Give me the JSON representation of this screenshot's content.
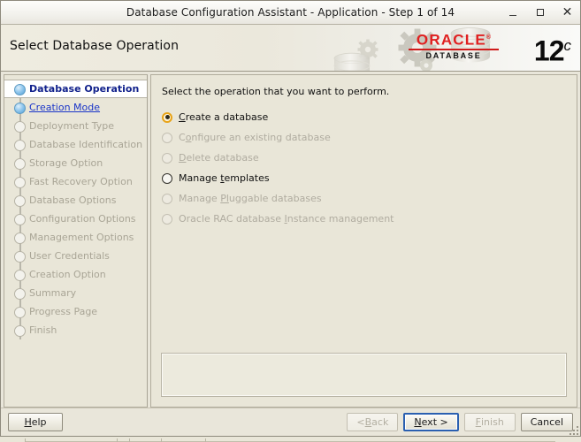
{
  "window": {
    "title": "Database Configuration Assistant - Application - Step 1 of 14",
    "minimize_icon": "minimize-icon",
    "maximize_icon": "maximize-icon",
    "close_icon": "close-icon"
  },
  "banner": {
    "title": "Select Database Operation",
    "brand": "ORACLE",
    "brand_registered": "®",
    "brand_sub": "DATABASE",
    "version_number": "12",
    "version_suffix": "c"
  },
  "sidebar": {
    "steps": [
      {
        "label": "Database Operation",
        "state": "current"
      },
      {
        "label": "Creation Mode",
        "state": "done"
      },
      {
        "label": "Deployment Type",
        "state": "pending"
      },
      {
        "label": "Database Identification",
        "state": "pending"
      },
      {
        "label": "Storage Option",
        "state": "pending"
      },
      {
        "label": "Fast Recovery Option",
        "state": "pending"
      },
      {
        "label": "Database Options",
        "state": "pending"
      },
      {
        "label": "Configuration Options",
        "state": "pending"
      },
      {
        "label": "Management Options",
        "state": "pending"
      },
      {
        "label": "User Credentials",
        "state": "pending"
      },
      {
        "label": "Creation Option",
        "state": "pending"
      },
      {
        "label": "Summary",
        "state": "pending"
      },
      {
        "label": "Progress Page",
        "state": "pending"
      },
      {
        "label": "Finish",
        "state": "pending"
      }
    ]
  },
  "main": {
    "intro": "Select the operation that you want to perform.",
    "options": [
      {
        "label": "Create a database",
        "pre": "",
        "mnemonic": "C",
        "post": "reate a database",
        "selected": true,
        "disabled": false
      },
      {
        "label": "Configure an existing database",
        "pre": "C",
        "mnemonic": "o",
        "post": "nfigure an existing database",
        "selected": false,
        "disabled": true
      },
      {
        "label": "Delete database",
        "pre": "",
        "mnemonic": "D",
        "post": "elete database",
        "selected": false,
        "disabled": true
      },
      {
        "label": "Manage templates",
        "pre": "Manage ",
        "mnemonic": "t",
        "post": "emplates",
        "selected": false,
        "disabled": false
      },
      {
        "label": "Manage Pluggable databases",
        "pre": "Manage ",
        "mnemonic": "Pl",
        "post": "uggable databases",
        "selected": false,
        "disabled": true
      },
      {
        "label": "Oracle RAC database Instance management",
        "pre": "Oracle RAC database ",
        "mnemonic": "I",
        "post": "nstance management",
        "selected": false,
        "disabled": true
      }
    ],
    "message_panel_text": ""
  },
  "footer": {
    "help": {
      "pre": "",
      "mnemonic": "H",
      "post": "elp",
      "disabled": false,
      "focused": false
    },
    "back": {
      "pre": "< ",
      "mnemonic": "B",
      "post": "ack",
      "disabled": true,
      "focused": false
    },
    "next": {
      "pre": "",
      "mnemonic": "N",
      "post": "ext >",
      "disabled": false,
      "focused": true
    },
    "finish": {
      "pre": "",
      "mnemonic": "F",
      "post": "inish",
      "disabled": true,
      "focused": false
    },
    "cancel": {
      "pre": "Cancel",
      "mnemonic": "",
      "post": "",
      "disabled": false,
      "focused": false
    }
  },
  "colors": {
    "brand_red": "#e02020",
    "accent_blue": "#2a5fb0",
    "selected_radio": "#e8a317",
    "link_blue": "#1a35c8",
    "current_step": "#12228c",
    "window_bg": "#e9e6da",
    "panel_bg": "#e9e6d8"
  }
}
